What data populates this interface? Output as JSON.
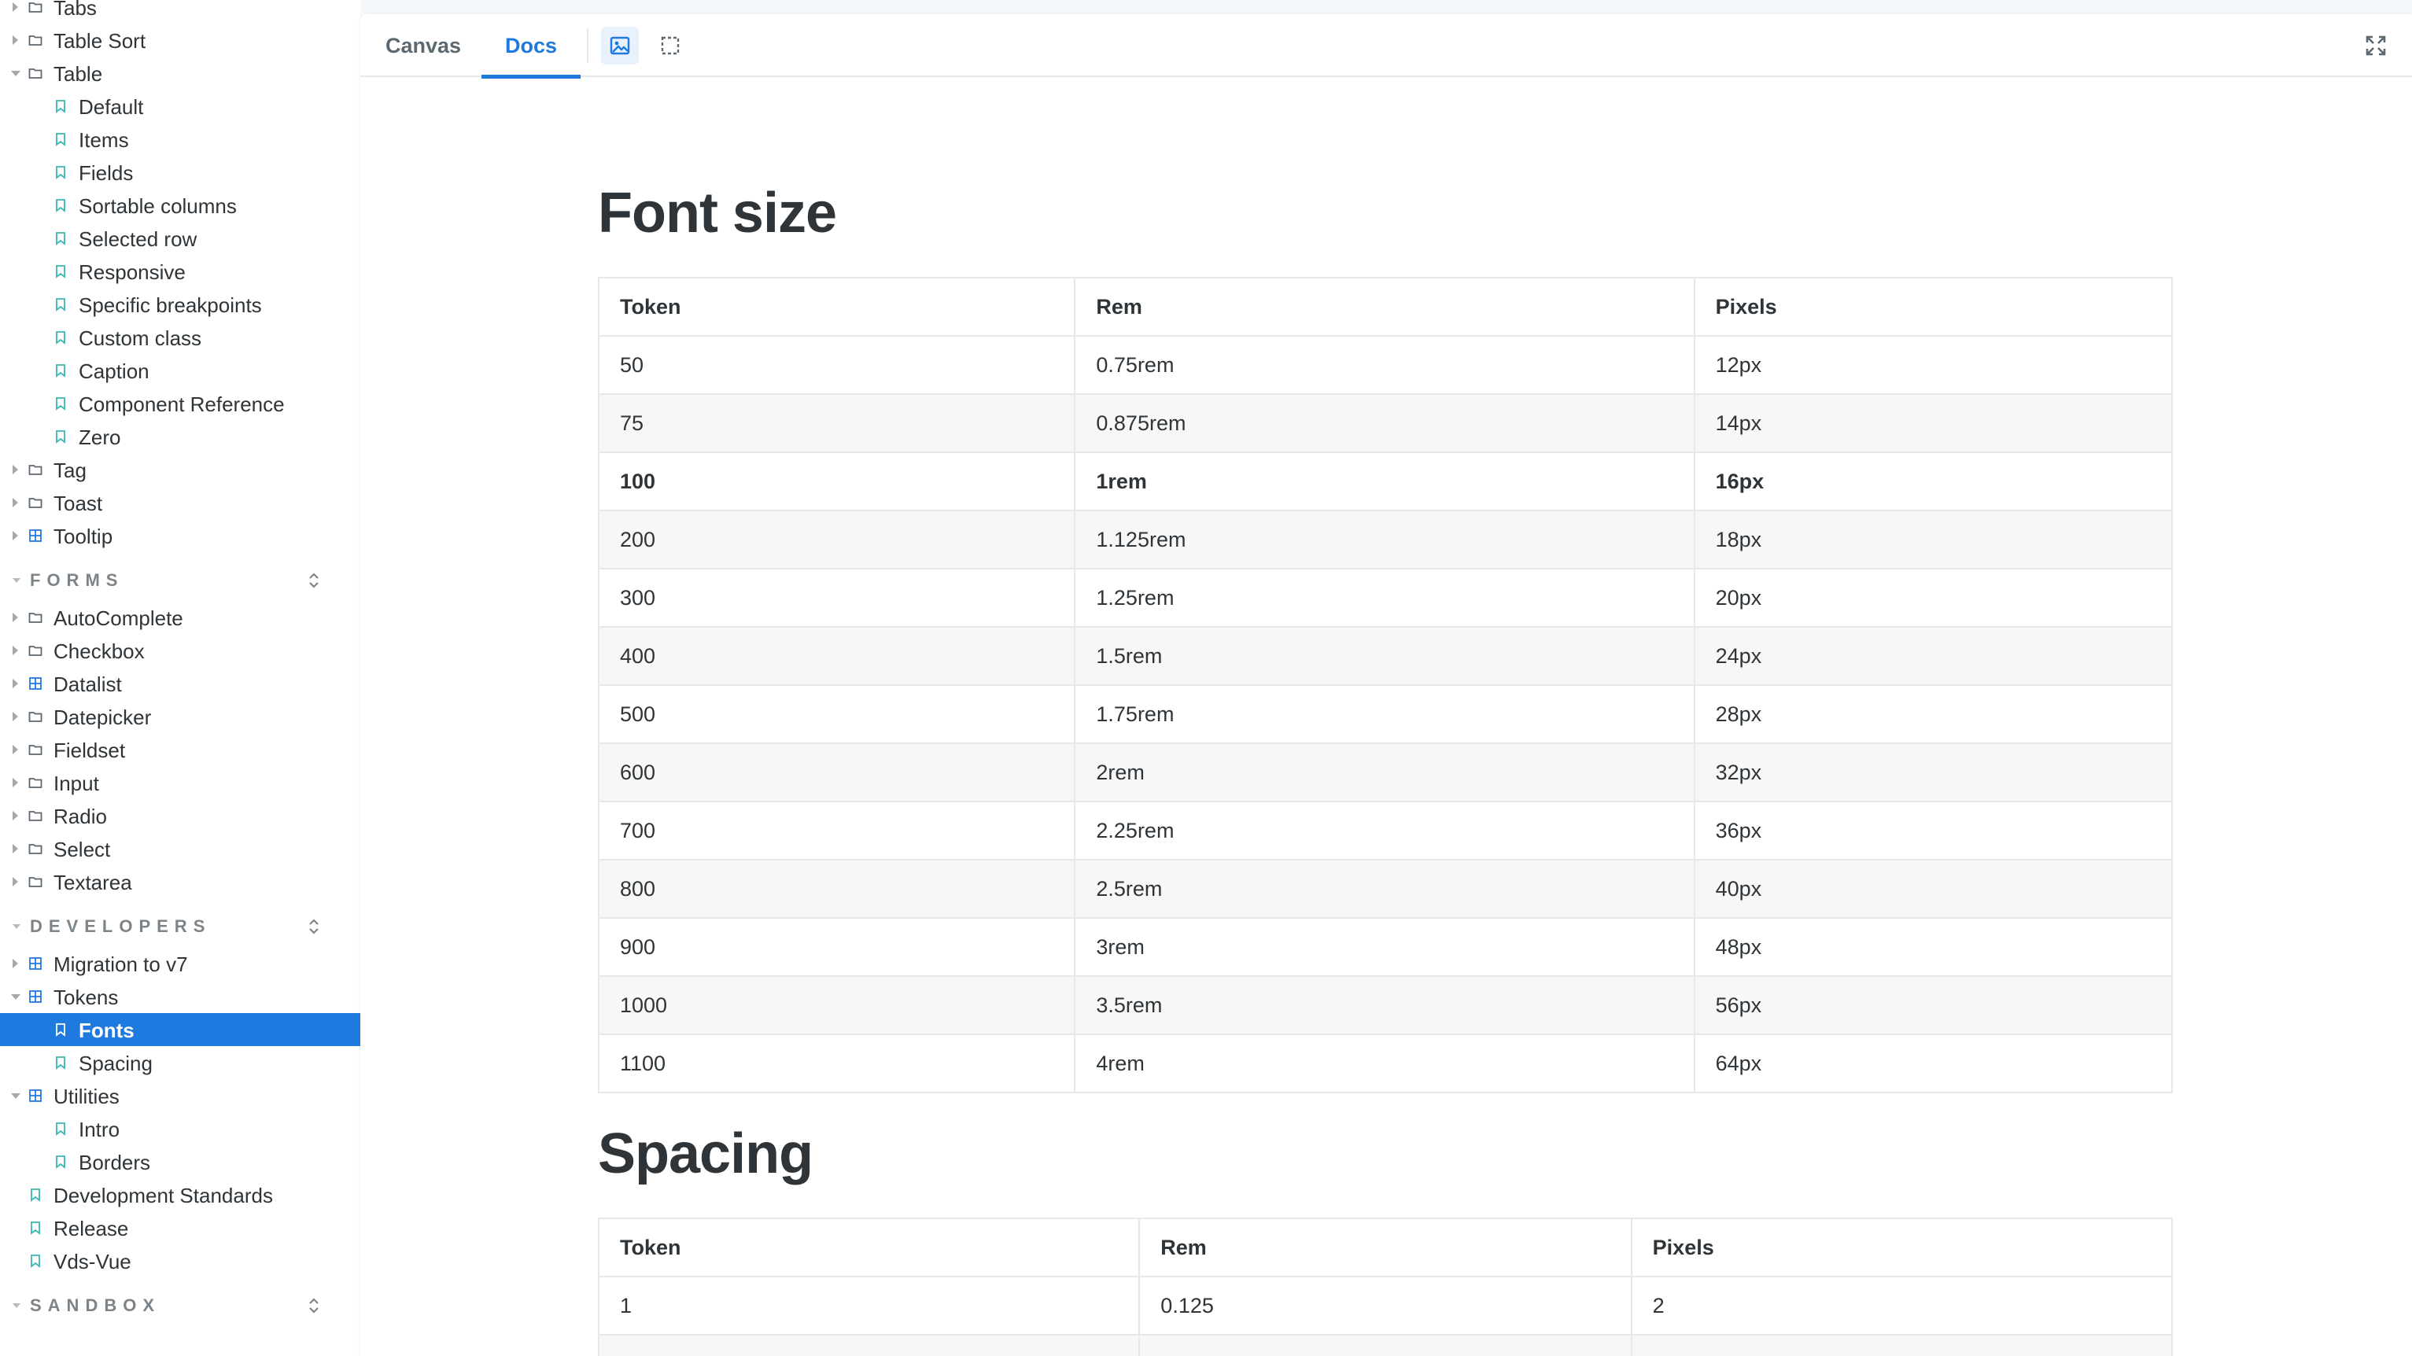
{
  "sidebar": {
    "rows": [
      {
        "label": "Tabs",
        "level": 1,
        "type": "folder",
        "caret": "right"
      },
      {
        "label": "Table Sort",
        "level": 1,
        "type": "folder",
        "caret": "right"
      },
      {
        "label": "Table",
        "level": 1,
        "type": "folder",
        "caret": "down"
      },
      {
        "label": "Default",
        "level": 2,
        "type": "story"
      },
      {
        "label": "Items",
        "level": 2,
        "type": "story"
      },
      {
        "label": "Fields",
        "level": 2,
        "type": "story"
      },
      {
        "label": "Sortable columns",
        "level": 2,
        "type": "story"
      },
      {
        "label": "Selected row",
        "level": 2,
        "type": "story"
      },
      {
        "label": "Responsive",
        "level": 2,
        "type": "story"
      },
      {
        "label": "Specific breakpoints",
        "level": 2,
        "type": "story"
      },
      {
        "label": "Custom class",
        "level": 2,
        "type": "story"
      },
      {
        "label": "Caption",
        "level": 2,
        "type": "story"
      },
      {
        "label": "Component Reference",
        "level": 2,
        "type": "story"
      },
      {
        "label": "Zero",
        "level": 2,
        "type": "story"
      },
      {
        "label": "Tag",
        "level": 1,
        "type": "folder",
        "caret": "right"
      },
      {
        "label": "Toast",
        "level": 1,
        "type": "folder",
        "caret": "right"
      },
      {
        "label": "Tooltip",
        "level": 1,
        "type": "component",
        "caret": "right"
      },
      {
        "section": "FORMS"
      },
      {
        "label": "AutoComplete",
        "level": 1,
        "type": "folder",
        "caret": "right"
      },
      {
        "label": "Checkbox",
        "level": 1,
        "type": "folder",
        "caret": "right"
      },
      {
        "label": "Datalist",
        "level": 1,
        "type": "component",
        "caret": "right"
      },
      {
        "label": "Datepicker",
        "level": 1,
        "type": "folder",
        "caret": "right"
      },
      {
        "label": "Fieldset",
        "level": 1,
        "type": "folder",
        "caret": "right"
      },
      {
        "label": "Input",
        "level": 1,
        "type": "folder",
        "caret": "right"
      },
      {
        "label": "Radio",
        "level": 1,
        "type": "folder",
        "caret": "right"
      },
      {
        "label": "Select",
        "level": 1,
        "type": "folder",
        "caret": "right"
      },
      {
        "label": "Textarea",
        "level": 1,
        "type": "folder",
        "caret": "right"
      },
      {
        "section": "DEVELOPERS"
      },
      {
        "label": "Migration to v7",
        "level": 1,
        "type": "component",
        "caret": "right"
      },
      {
        "label": "Tokens",
        "level": 1,
        "type": "component",
        "caret": "down"
      },
      {
        "label": "Fonts",
        "level": 2,
        "type": "story",
        "selected": true
      },
      {
        "label": "Spacing",
        "level": 2,
        "type": "story"
      },
      {
        "label": "Utilities",
        "level": 1,
        "type": "component",
        "caret": "down"
      },
      {
        "label": "Intro",
        "level": 2,
        "type": "story"
      },
      {
        "label": "Borders",
        "level": 2,
        "type": "story"
      },
      {
        "label": "Development Standards",
        "level": 1,
        "type": "doc"
      },
      {
        "label": "Release",
        "level": 1,
        "type": "doc"
      },
      {
        "label": "Vds-Vue",
        "level": 1,
        "type": "doc"
      },
      {
        "section": "SANDBOX"
      }
    ]
  },
  "toolbar": {
    "tabs": [
      {
        "label": "Canvas",
        "active": false
      },
      {
        "label": "Docs",
        "active": true
      }
    ],
    "tools": [
      {
        "icon": "image-icon",
        "active": true
      },
      {
        "icon": "outline-icon",
        "active": false
      }
    ],
    "fullscreen_icon": "fullscreen-icon"
  },
  "docs": {
    "font_size": {
      "heading": "Font size",
      "columns": [
        "Token",
        "Rem",
        "Pixels"
      ],
      "rows": [
        [
          "50",
          "0.75rem",
          "12px"
        ],
        [
          "75",
          "0.875rem",
          "14px"
        ],
        [
          "100",
          "1rem",
          "16px"
        ],
        [
          "200",
          "1.125rem",
          "18px"
        ],
        [
          "300",
          "1.25rem",
          "20px"
        ],
        [
          "400",
          "1.5rem",
          "24px"
        ],
        [
          "500",
          "1.75rem",
          "28px"
        ],
        [
          "600",
          "2rem",
          "32px"
        ],
        [
          "700",
          "2.25rem",
          "36px"
        ],
        [
          "800",
          "2.5rem",
          "40px"
        ],
        [
          "900",
          "3rem",
          "48px"
        ],
        [
          "1000",
          "3.5rem",
          "56px"
        ],
        [
          "1100",
          "4rem",
          "64px"
        ]
      ],
      "bold_row": 2
    },
    "spacing": {
      "heading": "Spacing",
      "columns": [
        "Token",
        "Rem",
        "Pixels"
      ],
      "rows": [
        [
          "1",
          "0.125",
          "2"
        ],
        [
          "",
          "",
          ""
        ]
      ]
    }
  },
  "colors": {
    "accent": "#1f7ae0",
    "story_icon": "#37b8b0",
    "component_icon": "#1f7ae0",
    "folder_icon": "#5c6870"
  }
}
